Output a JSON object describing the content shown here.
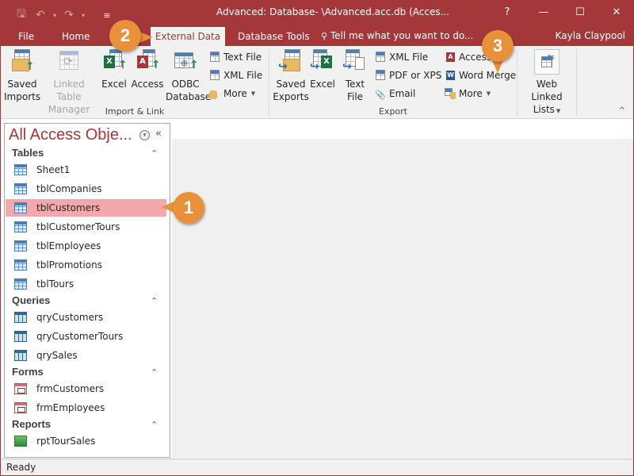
{
  "window": {
    "title": "Advanced: Database- \\Advanced.acc.db (Acces...",
    "help": "?",
    "minimize": "—",
    "maximize": "☐",
    "close": "✕"
  },
  "qat": {
    "save_icon": "save-icon",
    "undo": "↶",
    "redo": "↷",
    "dropdown": "▾",
    "customize": "≡"
  },
  "tabs": [
    {
      "label": "File"
    },
    {
      "label": "Home"
    },
    {
      "label": "External Data",
      "active": true
    },
    {
      "label": "Database Tools"
    }
  ],
  "tellme": {
    "icon": "💡",
    "placeholder": "Tell me what you want to do..."
  },
  "user": "Kayla Claypool",
  "ribbon": {
    "import_link": {
      "label": "Import & Link",
      "saved_imports": [
        "Saved",
        "Imports"
      ],
      "linked_table_manager": [
        "Linked Table",
        "Manager"
      ],
      "excel": "Excel",
      "access": "Access",
      "odbc": [
        "ODBC",
        "Database"
      ],
      "text_file": "Text File",
      "xml_file": "XML File",
      "more": "More"
    },
    "export": {
      "label": "Export",
      "saved_exports": [
        "Saved",
        "Exports"
      ],
      "excel": "Excel",
      "text_file": [
        "Text",
        "File"
      ],
      "xml_file": "XML File",
      "pdf_xps": "PDF or XPS",
      "email": "Email",
      "access": "Access",
      "word_merge": "Word Merge",
      "more": "More"
    },
    "web_linked": {
      "label": [
        "Web Linked",
        "Lists"
      ]
    },
    "collapse": "^"
  },
  "nav": {
    "title": "All Access Obje...",
    "dropdown_icon": "▾",
    "shutter": "«",
    "sections": [
      {
        "name": "Tables",
        "items": [
          "Sheet1",
          "tblCompanies",
          "tblCustomers",
          "tblCustomerTours",
          "tblEmployees",
          "tblPromotions",
          "tblTours"
        ],
        "selected": "tblCustomers"
      },
      {
        "name": "Queries",
        "items": [
          "qryCustomers",
          "qryCustomerTours",
          "qrySales"
        ]
      },
      {
        "name": "Forms",
        "items": [
          "frmCustomers",
          "frmEmployees"
        ]
      },
      {
        "name": "Reports",
        "items": [
          "rptTourSales"
        ]
      }
    ],
    "collapse_chevron": "⌃"
  },
  "status": "Ready",
  "callouts": [
    "1",
    "2",
    "3"
  ],
  "colors": {
    "accent": "#a4373a",
    "selected": "#f4a8ac",
    "callout": "#e8913a"
  }
}
